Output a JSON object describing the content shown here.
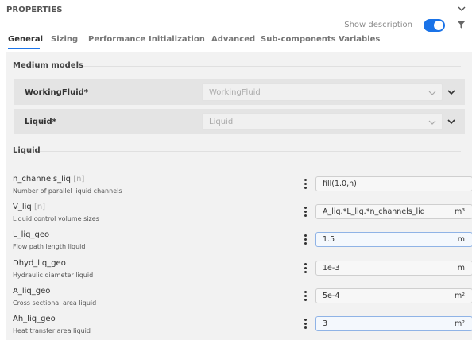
{
  "panel": {
    "title": "PROPERTIES"
  },
  "toolbar": {
    "show_description_label": "Show description",
    "show_description_on": true
  },
  "tabs": [
    {
      "label": "General",
      "active": true
    },
    {
      "label": "Sizing",
      "active": false
    },
    {
      "label": "Performance",
      "active": false
    },
    {
      "label": "Initialization",
      "active": false
    },
    {
      "label": "Advanced",
      "active": false
    },
    {
      "label": "Sub-components",
      "active": false
    },
    {
      "label": "Variables",
      "active": false
    }
  ],
  "medium_models": {
    "title": "Medium models",
    "rows": [
      {
        "label": "WorkingFluid*",
        "value": "WorkingFluid"
      },
      {
        "label": "Liquid*",
        "value": "Liquid"
      }
    ]
  },
  "liquid": {
    "title": "Liquid",
    "params": [
      {
        "name": "n_channels_liq",
        "unit_hint": "[n]",
        "description": "Number of parallel liquid channels",
        "value": "fill(1.0,n)",
        "unit": ""
      },
      {
        "name": "V_liq",
        "unit_hint": "[n]",
        "description": "Liquid control volume sizes",
        "value": "A_liq.*L_liq.*n_channels_liq",
        "unit": "m³"
      },
      {
        "name": "L_liq_geo",
        "unit_hint": "",
        "description": "Flow path length liquid",
        "value": "1.5",
        "unit": "m"
      },
      {
        "name": "Dhyd_liq_geo",
        "unit_hint": "",
        "description": "Hydraulic diameter liquid",
        "value": "1e-3",
        "unit": "m"
      },
      {
        "name": "A_liq_geo",
        "unit_hint": "",
        "description": "Cross sectional area liquid",
        "value": "5e-4",
        "unit": "m²"
      },
      {
        "name": "Ah_liq_geo",
        "unit_hint": "",
        "description": "Heat transfer area liquid",
        "value": "3",
        "unit": "m²"
      }
    ]
  },
  "colors": {
    "accent": "#1a73e8",
    "panel_bg": "#f2f2f2",
    "row_bg": "#e4e4e4"
  },
  "icons": [
    "chevron-down-icon",
    "filter-icon",
    "kebab-icon"
  ]
}
